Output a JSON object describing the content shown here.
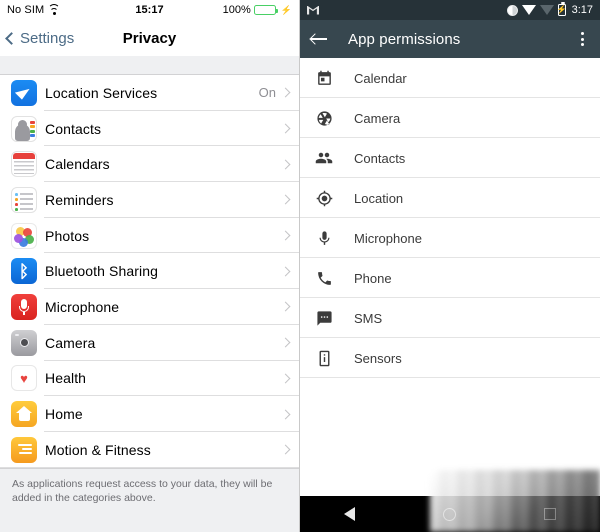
{
  "ios": {
    "status": {
      "carrier": "No SIM",
      "wifi_icon": "wifi-icon",
      "time": "15:17",
      "battery_pct": "100%",
      "battery_icon": "battery-charging-icon",
      "battery_color": "#49d065"
    },
    "navbar": {
      "back_label": "Settings",
      "back_icon": "chevron-left-icon",
      "title": "Privacy"
    },
    "rows": [
      {
        "label": "Location Services",
        "value": "On",
        "icon": "location-arrow-icon"
      },
      {
        "label": "Contacts",
        "value": "",
        "icon": "contacts-icon"
      },
      {
        "label": "Calendars",
        "value": "",
        "icon": "calendar-icon"
      },
      {
        "label": "Reminders",
        "value": "",
        "icon": "reminders-icon"
      },
      {
        "label": "Photos",
        "value": "",
        "icon": "photos-icon"
      },
      {
        "label": "Bluetooth Sharing",
        "value": "",
        "icon": "bluetooth-icon"
      },
      {
        "label": "Microphone",
        "value": "",
        "icon": "microphone-icon"
      },
      {
        "label": "Camera",
        "value": "",
        "icon": "camera-icon"
      },
      {
        "label": "Health",
        "value": "",
        "icon": "heart-icon"
      },
      {
        "label": "Home",
        "value": "",
        "icon": "home-icon"
      },
      {
        "label": "Motion & Fitness",
        "value": "",
        "icon": "motion-fitness-icon"
      }
    ],
    "footer": "As applications request access to your data, they will be added in the categories above."
  },
  "android": {
    "status": {
      "app_icon": "gmail-icon",
      "dnd_icon": "do-not-disturb-icon",
      "wifi_icon": "wifi-icon",
      "signal_icon": "signal-icon",
      "battery_icon": "battery-charging-icon",
      "time": "3:17"
    },
    "appbar": {
      "back_icon": "arrow-back-icon",
      "title": "App permissions",
      "overflow_icon": "more-vert-icon"
    },
    "rows": [
      {
        "label": "Calendar",
        "icon": "calendar-icon"
      },
      {
        "label": "Camera",
        "icon": "camera-aperture-icon"
      },
      {
        "label": "Contacts",
        "icon": "contacts-icon"
      },
      {
        "label": "Location",
        "icon": "location-target-icon"
      },
      {
        "label": "Microphone",
        "icon": "microphone-icon"
      },
      {
        "label": "Phone",
        "icon": "phone-icon"
      },
      {
        "label": "SMS",
        "icon": "sms-icon"
      },
      {
        "label": "Sensors",
        "icon": "sensors-icon"
      }
    ],
    "navbar": {
      "back_icon": "nav-back-triangle-icon",
      "home_icon": "nav-home-circle-icon",
      "recents_icon": "nav-recents-square-icon"
    }
  },
  "colors": {
    "ios_accent": "#4c6b86",
    "android_appbar": "#37474f",
    "android_statusbar": "#263238",
    "ios_gap": "#eff0f2"
  }
}
